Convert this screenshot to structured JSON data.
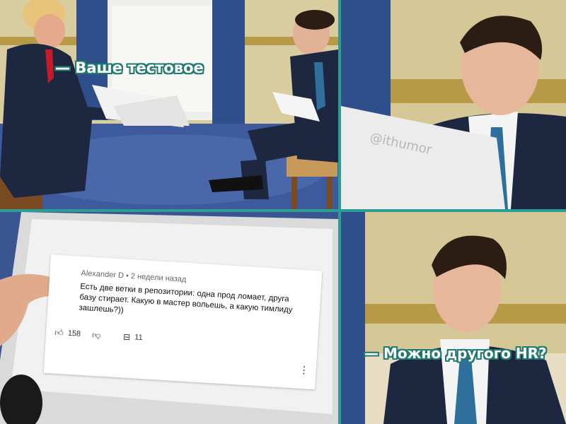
{
  "panels": {
    "top_left": {
      "caption": "— Ваше тестовое"
    },
    "top_right": {
      "watermark": "@ithumor"
    },
    "bottom_left": {
      "comment": {
        "author": "Alexander D",
        "time": "2 недели назад",
        "text": "Есть две ветки в репозитории: одна прод ломает, друга базу стирает. Какую в мастер вольешь, а какую тимлиду зашлешь?))",
        "likes": "158",
        "replies": "11",
        "like_icon": "thumbs-up-icon",
        "dislike_icon": "thumbs-down-icon",
        "reply_icon": "reply-icon",
        "menu_icon": "more-vertical-icon"
      }
    },
    "bottom_right": {
      "caption": "— Можно другого HR?"
    }
  },
  "colors": {
    "border": "#2a9d95",
    "caption_outline": "#1f7a70",
    "curtain": "#2e4f8a",
    "wall": "#d7c999",
    "carpet": "#3d5a9c",
    "suit": "#1d2740",
    "tie_blue": "#2f6f9c",
    "tie_red": "#c61a2a"
  }
}
